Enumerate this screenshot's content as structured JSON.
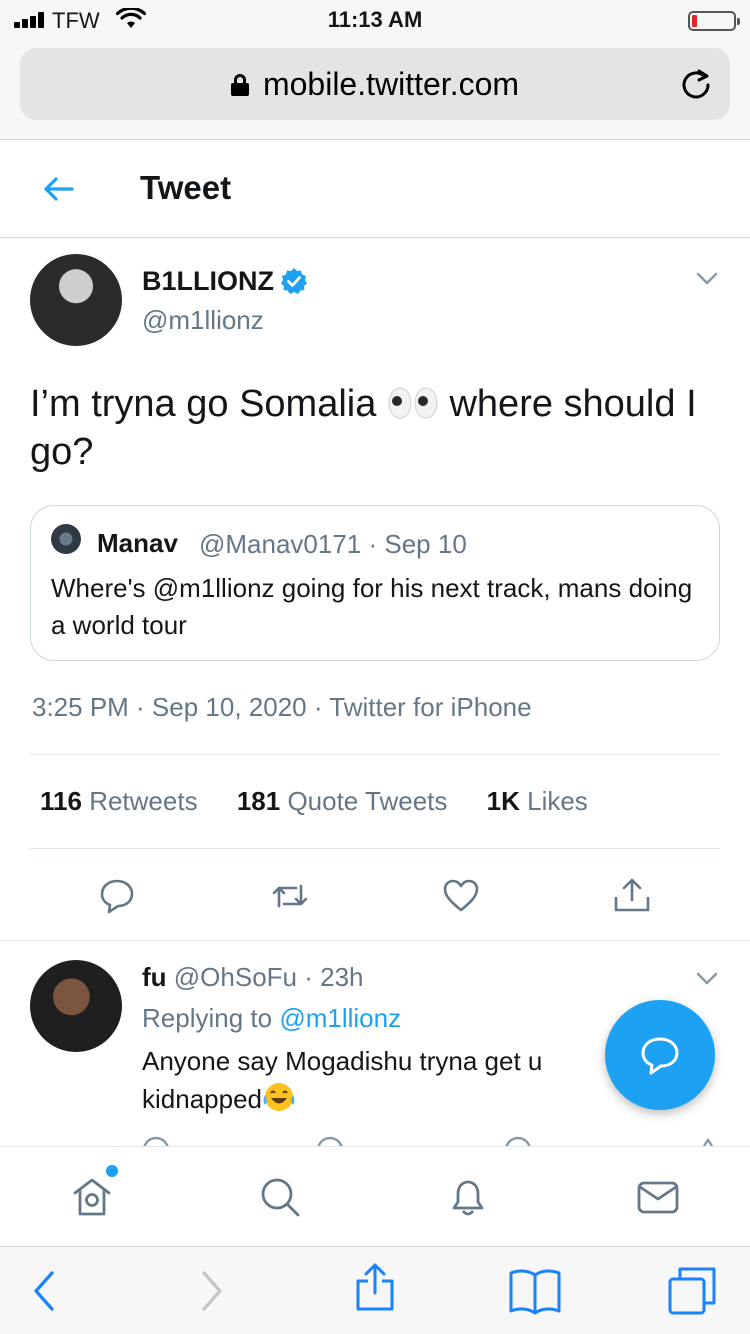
{
  "status_bar": {
    "carrier": "TFW",
    "time": "11:13 AM",
    "battery_level": 0.1,
    "battery_color": "#e0262a"
  },
  "browser": {
    "url": "mobile.twitter.com"
  },
  "header": {
    "title": "Tweet"
  },
  "tweet": {
    "author_name": "B1LLIONZ",
    "author_handle": "@m1llionz",
    "verified": true,
    "text_before": "I’m tryna go Somalia ",
    "emoji": "eyes-emoji",
    "text_after": " where should I go?",
    "timestamp": "3:25 PM · Sep 10, 2020 · Twitter for iPhone"
  },
  "quote": {
    "name": "Manav",
    "meta": "@Manav0171 · Sep 10",
    "text": "Where's @m1llionz going for his next track, mans doing a world tour"
  },
  "stats": [
    {
      "count": "116",
      "label": "Retweets"
    },
    {
      "count": "181",
      "label": "Quote Tweets"
    },
    {
      "count": "1K",
      "label": "Likes"
    }
  ],
  "actions": [
    "reply-icon",
    "retweet-icon",
    "like-icon",
    "share-icon"
  ],
  "reply": {
    "name": "fu",
    "meta": "@OhSoFu · 23h",
    "replying_prefix": "Replying to ",
    "replying_mention": "@m1llionz",
    "text": "Anyone say Mogadishu tryna get u kidnapped",
    "emoji": "tears-of-joy-emoji"
  },
  "bottom_nav": [
    "home-icon",
    "search-icon",
    "notifications-icon",
    "messages-icon"
  ],
  "safari_toolbar": [
    "back-icon",
    "forward-icon",
    "share-icon",
    "bookmarks-icon",
    "tabs-icon"
  ],
  "colors": {
    "accent": "#1da1f2",
    "secondary_text": "#657786",
    "primary_text": "#14171a",
    "border": "#ccd6dd"
  }
}
